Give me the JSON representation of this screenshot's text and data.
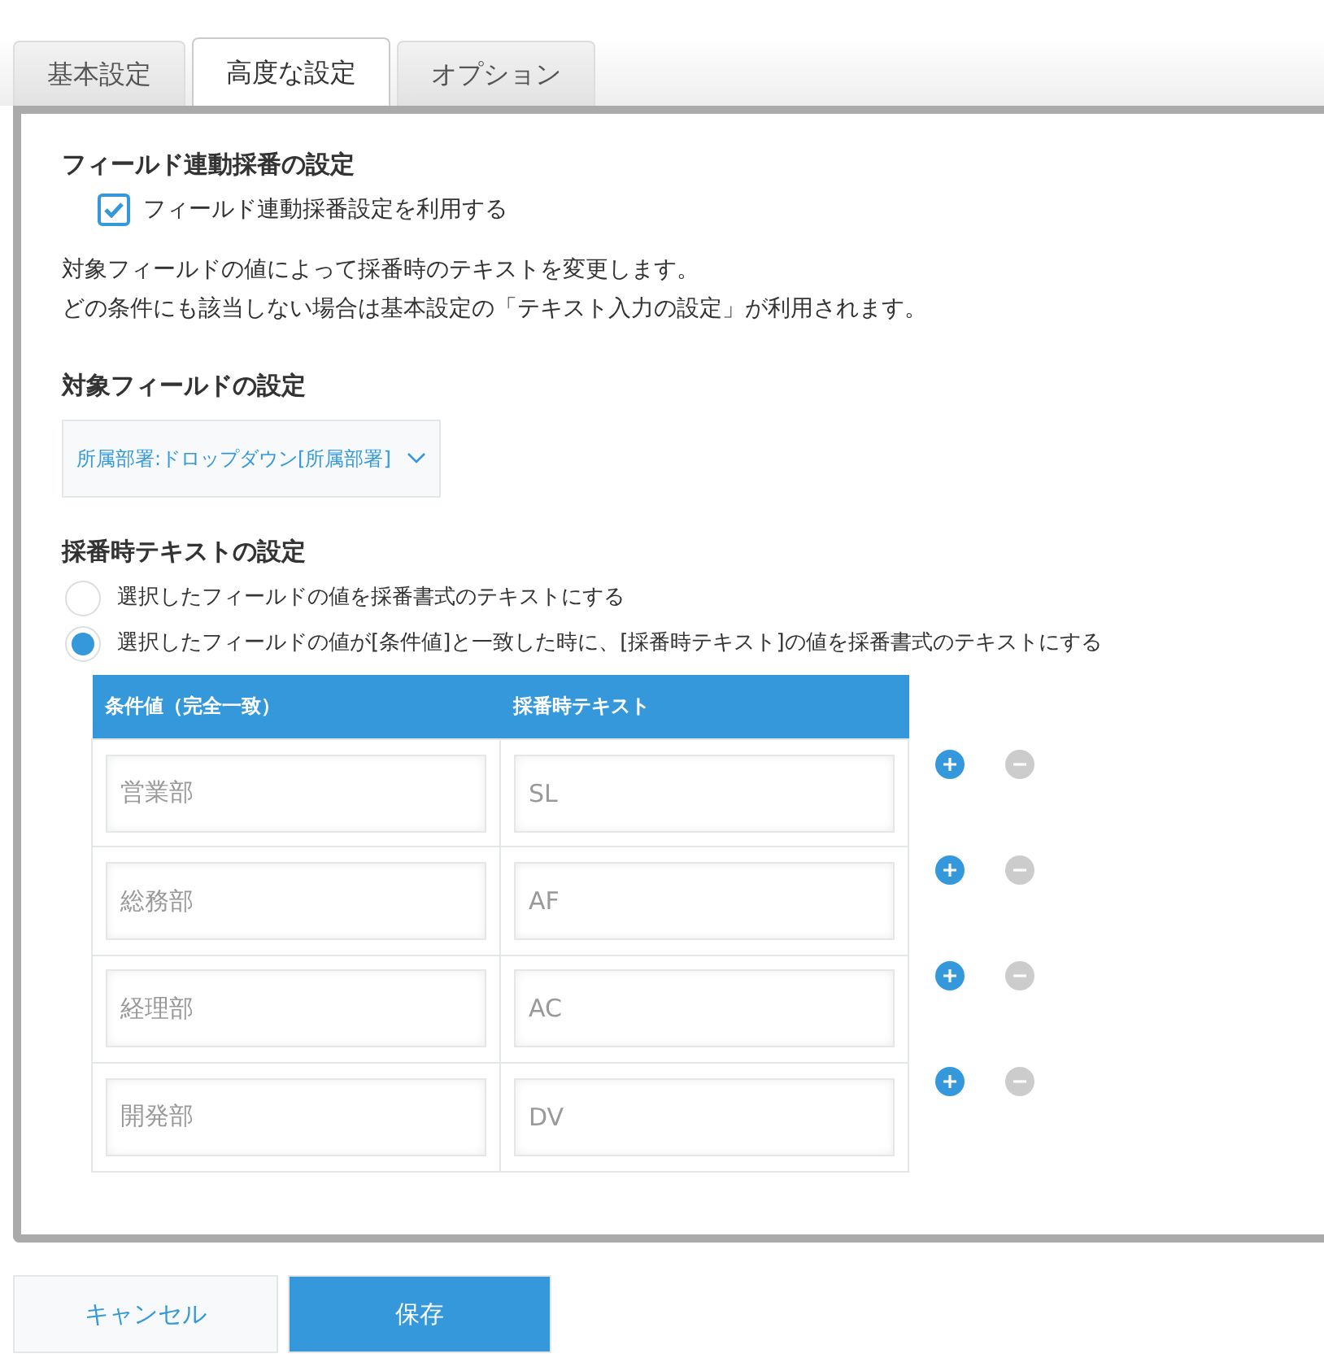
{
  "tabs": [
    {
      "label": "基本設定",
      "selected": false
    },
    {
      "label": "高度な設定",
      "selected": true
    },
    {
      "label": "オプション",
      "selected": false
    }
  ],
  "link_section": {
    "title": "フィールド連動採番の設定",
    "checkbox": {
      "label": "フィールド連動採番設定を利用する",
      "checked": true
    },
    "description": [
      "対象フィールドの値によって採番時のテキストを変更します。",
      "どの条件にも該当しない場合は基本設定の「テキスト入力の設定」が利用されます。"
    ]
  },
  "field_section": {
    "title": "対象フィールドの設定",
    "dropdown": {
      "value": "所属部署:ドロップダウン[所属部署]"
    }
  },
  "text_section": {
    "title": "採番時テキストの設定",
    "options": [
      {
        "label": "選択したフィールドの値を採番書式のテキストにする",
        "selected": false
      },
      {
        "label": "選択したフィールドの値が[条件値]と一致した時に、[採番時テキスト]の値を採番書式のテキストにする",
        "selected": true
      }
    ],
    "table": {
      "columns": [
        "条件値（完全一致）",
        "採番時テキスト"
      ],
      "rows": [
        {
          "condition": "営業部",
          "text": "SL"
        },
        {
          "condition": "総務部",
          "text": "AF"
        },
        {
          "condition": "経理部",
          "text": "AC"
        },
        {
          "condition": "開発部",
          "text": "DV"
        }
      ]
    }
  },
  "buttons": {
    "cancel": "キャンセル",
    "save": "保存"
  }
}
